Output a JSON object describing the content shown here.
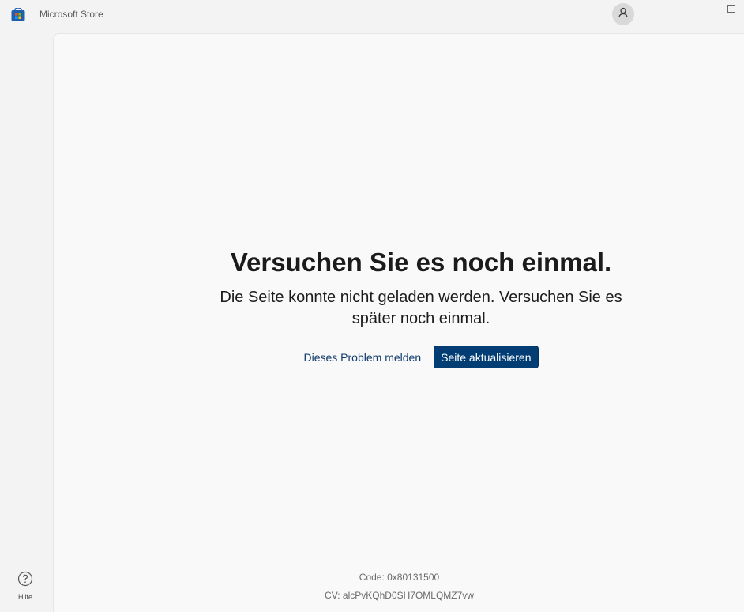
{
  "app": {
    "title": "Microsoft Store",
    "icon": "store-bag-icon"
  },
  "titlebar": {
    "account_icon": "person-icon",
    "minimize_icon": "minimize-icon",
    "maximize_icon": "maximize-icon"
  },
  "nav": {
    "help": {
      "label": "Hilfe",
      "icon": "question-circle-icon"
    }
  },
  "error": {
    "title": "Versuchen Sie es noch einmal.",
    "message": "Die Seite konnte nicht geladen werden. Versuchen Sie es später noch einmal.",
    "report_link": "Dieses Problem melden",
    "refresh_button": "Seite aktualisieren"
  },
  "footer": {
    "code": "Code: 0x80131500",
    "cv": "CV: alcPvKQhD0SH7OMLQMZ7vw"
  },
  "colors": {
    "accent": "#023e74",
    "link": "#0f3a6b",
    "background": "#f3f3f3",
    "content_bg": "#f9f9f9"
  }
}
